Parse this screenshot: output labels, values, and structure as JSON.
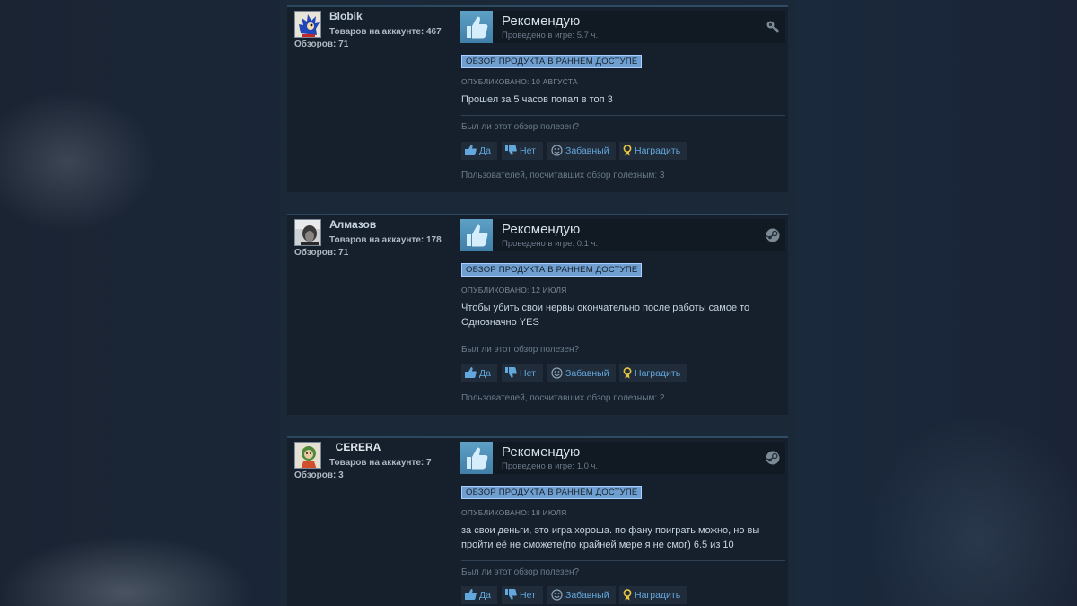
{
  "ui": {
    "recommend_label": "Рекомендую",
    "early_access_tag": "ОБЗОР ПРОДУКТА В РАННЕМ ДОСТУПЕ",
    "helpful_question": "Был ли этот обзор полезен?",
    "btn_yes": "Да",
    "btn_no": "Нет",
    "btn_funny": "Забавный",
    "btn_award": "Наградить",
    "colors": {
      "accent": "#62a8dc",
      "tag_bg": "#6f9fd0",
      "panel": "#16202d",
      "page": "#1b2838"
    }
  },
  "reviews": [
    {
      "author": "Blobik",
      "products": "Товаров на аккаунте: 467",
      "review_count": "Обзоров: 71",
      "avatar_icon": "hedgehog-avatar-icon",
      "playtime": "Проведено в игре: 5.7 ч.",
      "corner_icon": "key-icon",
      "posted": "ОПУБЛИКОВАНО: 10 АВГУСТА",
      "text": "Прошел за 5 часов попал в топ 3",
      "helpful_count": "Пользователей, посчитавших обзор полезным: 3"
    },
    {
      "author": "Алмазов",
      "products": "Товаров на аккаунте: 178",
      "review_count": "Обзоров: 71",
      "avatar_icon": "portrait-avatar-icon",
      "playtime": "Проведено в игре: 0.1 ч.",
      "corner_icon": "steam-icon",
      "posted": "ОПУБЛИКОВАНО: 12 ИЮЛЯ",
      "text": "Чтобы убить свои нервы окончательно после работы самое то Однозначно YES",
      "helpful_count": "Пользователей, посчитавших обзор полезным: 2"
    },
    {
      "author": "_CERERA_",
      "products": "Товаров на аккаунте: 7",
      "review_count": "Обзоров: 3",
      "avatar_icon": "character-avatar-icon",
      "playtime": "Проведено в игре: 1.0 ч.",
      "corner_icon": "steam-icon",
      "posted": "ОПУБЛИКОВАНО: 18 ИЮЛЯ",
      "text": "за свои деньги, это игра хороша. по фану поиграть можно, но вы пройти её не сможете(по крайней мере я не смог) 6.5 из 10",
      "helpful_count": ""
    }
  ]
}
